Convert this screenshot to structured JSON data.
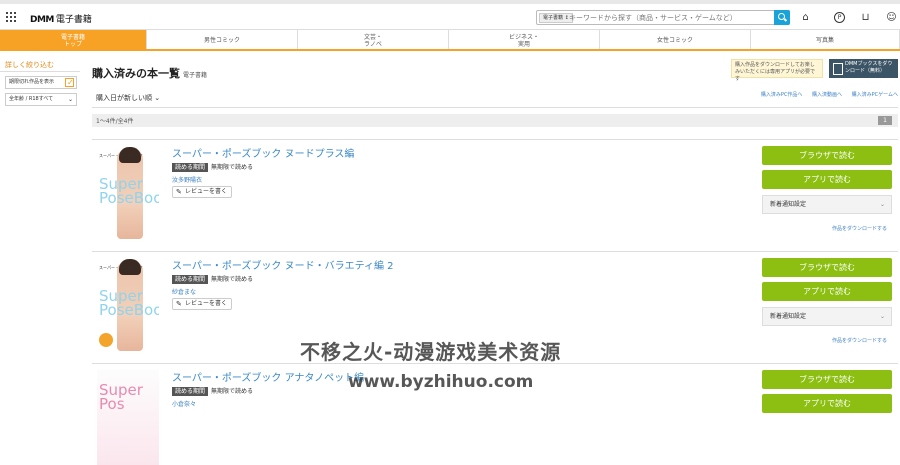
{
  "header": {
    "logo": "DMM",
    "logo_sub": "電子書籍",
    "search_category": "電子書籍 ↕",
    "search_placeholder": "キーワードから探す（商品・サービス・ゲームなど）"
  },
  "nav": {
    "tabs": [
      {
        "label": "電子書籍\nトップ",
        "active": true
      },
      {
        "label": "男性コミック",
        "active": false
      },
      {
        "label": "文芸・\nラノベ",
        "active": false
      },
      {
        "label": "ビジネス・\n実用",
        "active": false
      },
      {
        "label": "女性コミック",
        "active": false
      },
      {
        "label": "写真集",
        "active": false
      }
    ]
  },
  "sidebar": {
    "title": "詳しく絞り込む",
    "filter_expired": "期限切れ作品を表示",
    "filter_age": "全年齢 / R18すべて"
  },
  "main": {
    "title": "購入済みの本一覧",
    "title_sub": "電子書籍",
    "dl_note": "購入作品をダウンロードしてお楽しみいただくには専用アプリが必要です",
    "dl_button": "DMMブックスをダウンロード（無料）",
    "sort_label": "購入日が新しい順 ⌄",
    "sort_links": [
      "購入済みPC作品へ",
      "購入済動画へ",
      "購入済みPCゲームへ"
    ],
    "count": "1〜4件/全4件",
    "page": "1"
  },
  "books": [
    {
      "title": "スーパー・ポーズブック ヌードプラス編",
      "tag": "読める期間",
      "period": "無期限で読める",
      "author": "汝多野陽衣",
      "review": "レビューを書く",
      "read_browser": "ブラウザで読む",
      "read_app": "アプリで読む",
      "notify": "新着通知設定",
      "download": "作品をダウンロードする",
      "cover_big": "Super PoseBook",
      "cover_small": "スーパー・ポーズブック"
    },
    {
      "title": "スーパー・ポーズブック ヌード・バラエティ編 2",
      "tag": "読める期間",
      "period": "無期限で読める",
      "author": "紗倉まな",
      "review": "レビューを書く",
      "read_browser": "ブラウザで読む",
      "read_app": "アプリで読む",
      "notify": "新着通知設定",
      "download": "作品をダウンロードする",
      "cover_big": "Super PoseBook",
      "cover_small": "スーパー・ポーズブック"
    },
    {
      "title": "スーパー・ポーズブック アナタノペット編",
      "tag": "読める期間",
      "period": "無期限で読める",
      "author": "小倉奈々",
      "read_browser": "ブラウザで読む",
      "read_app": "アプリで読む",
      "cover_big": "Super Pos"
    }
  ],
  "watermark": {
    "line1": "不移之火-动漫游戏美术资源",
    "line2": "www.byzhihuo.com"
  },
  "colors": {
    "accent_orange": "#f7a125",
    "button_green": "#8cbf12",
    "link_blue": "#3a88c8"
  }
}
